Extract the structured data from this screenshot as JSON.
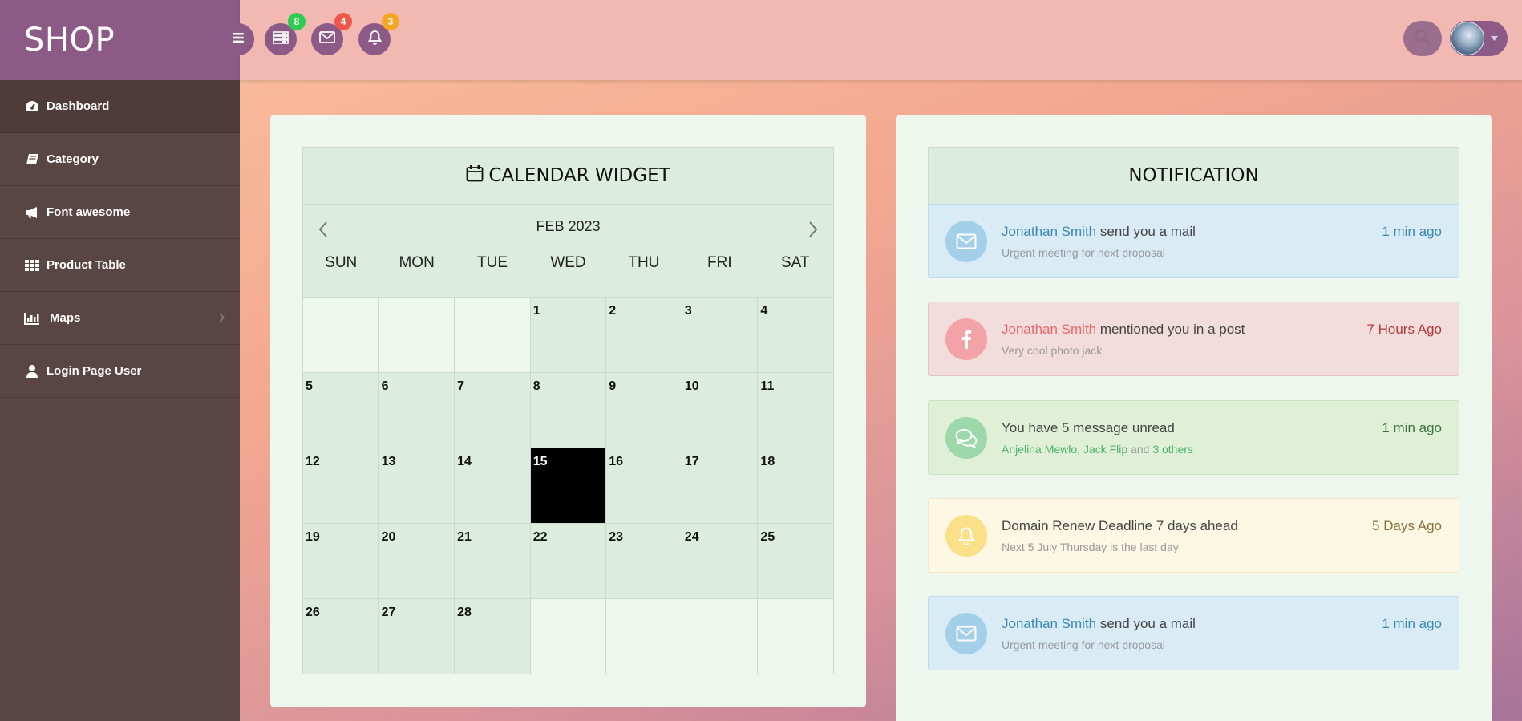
{
  "brand": "SHOP",
  "sidebar": {
    "items": [
      {
        "label": "Dashboard",
        "icon": "dashboard-icon",
        "active": true
      },
      {
        "label": "Category",
        "icon": "book-icon"
      },
      {
        "label": "Font awesome",
        "icon": "bullhorn-icon"
      },
      {
        "label": "Product Table",
        "icon": "table-icon"
      },
      {
        "label": "Maps",
        "icon": "bar-chart-icon",
        "has_submenu": true
      },
      {
        "label": "Login Page User",
        "icon": "user-icon"
      }
    ]
  },
  "topbar": {
    "tasks_badge": "8",
    "mail_badge": "4",
    "bell_badge": "3",
    "colors": {
      "tasks_badge": "#2ecc52",
      "mail_badge": "#f0564a",
      "bell_badge": "#f5a623"
    }
  },
  "calendar": {
    "title": "CALENDAR WIDGET",
    "month": "FEB 2023",
    "weekdays": [
      "SUN",
      "MON",
      "TUE",
      "WED",
      "THU",
      "FRI",
      "SAT"
    ],
    "leading_blanks": 3,
    "days_in_month": 28,
    "today": 15
  },
  "notifications": {
    "title": "NOTIFICATION",
    "items": [
      {
        "type": "info",
        "icon": "envelope-icon",
        "highlight": "Jonathan Smith",
        "text": " send you a mail",
        "sub": "Urgent meeting for next proposal",
        "time": "1 min ago"
      },
      {
        "type": "danger",
        "icon": "facebook-icon",
        "highlight": "Jonathan Smith",
        "text": " mentioned you in a post",
        "sub": "Very cool photo jack",
        "time": "7 Hours Ago"
      },
      {
        "type": "success",
        "icon": "comments-icon",
        "highlight": "",
        "text": "You have 5 message unread",
        "sub_highlight": "Anjelina Mewlo, Jack Flip",
        "sub_mid": " and ",
        "sub_highlight2": "3 others",
        "time": "1 min ago"
      },
      {
        "type": "warning",
        "icon": "bell-icon",
        "highlight": "",
        "text": "Domain Renew Deadline 7 days ahead",
        "sub": "Next 5 July Thursday is the last day",
        "time": "5 Days Ago"
      },
      {
        "type": "info",
        "icon": "envelope-icon",
        "highlight": "Jonathan Smith",
        "text": " send you a mail",
        "sub": "Urgent meeting for next proposal",
        "time": "1 min ago"
      }
    ]
  }
}
